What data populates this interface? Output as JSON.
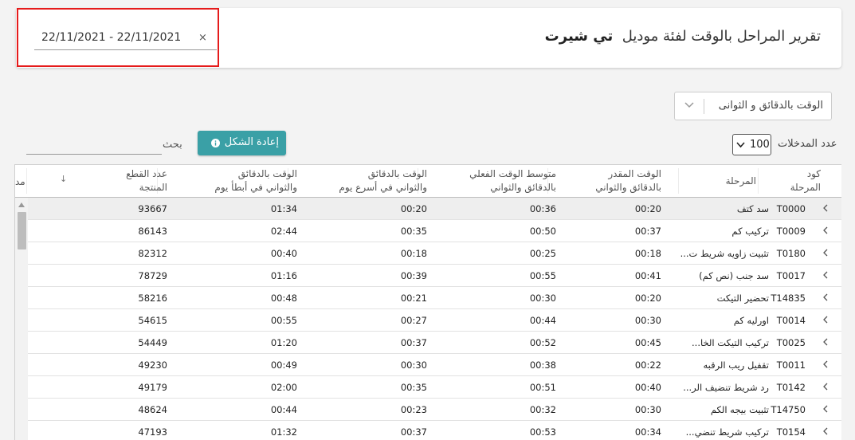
{
  "header": {
    "title": "تقرير المراحل بالوقت لفئة موديل",
    "model": "تي شيرت",
    "date_range": "22/11/2021  -  22/11/2021",
    "clear": "×"
  },
  "controls": {
    "mode_select": "الوقت بالدقائق و الثوانى",
    "entries_label": "عدد المدخلات",
    "entries_value": "100",
    "reset_label": "إعادة الشكل",
    "search_label": "بحث",
    "search_value": "",
    "search_placeholder": ""
  },
  "table": {
    "headers": {
      "code": [
        "كود",
        "المرحلة"
      ],
      "stage": "المرحلة",
      "est": [
        "الوقت المقدر",
        "بالدقائق والثواني"
      ],
      "act": [
        "متوسط الوقت الفعلي",
        "بالدقائق والثواني"
      ],
      "fast": [
        "الوقت بالدقائق",
        "والثواني في أسرع يوم"
      ],
      "slow": [
        "الوقت بالدقائق",
        "والثواني في أبطأ يوم"
      ],
      "cut": [
        "عدد القطع",
        "المنتجة"
      ],
      "trunc": "مد"
    },
    "rows": [
      {
        "code": "T0000",
        "stage": "سد كتف",
        "est": "00:20",
        "act": "00:36",
        "fast": "00:20",
        "slow": "01:34",
        "cut": "93667"
      },
      {
        "code": "T0009",
        "stage": "تركيب كم",
        "est": "00:37",
        "act": "00:50",
        "fast": "00:35",
        "slow": "02:44",
        "cut": "86143"
      },
      {
        "code": "T0180",
        "stage": "تثبيت زاويه شريط ت...",
        "est": "00:18",
        "act": "00:25",
        "fast": "00:18",
        "slow": "00:40",
        "cut": "82312"
      },
      {
        "code": "T0017",
        "stage": "سد جنب (نص كم)",
        "est": "00:41",
        "act": "00:55",
        "fast": "00:39",
        "slow": "01:16",
        "cut": "78729"
      },
      {
        "code": "T14835",
        "stage": "تحضير التيكت",
        "est": "00:20",
        "act": "00:30",
        "fast": "00:21",
        "slow": "00:48",
        "cut": "58216"
      },
      {
        "code": "T0014",
        "stage": "اورليه كم",
        "est": "00:30",
        "act": "00:44",
        "fast": "00:27",
        "slow": "00:55",
        "cut": "54615"
      },
      {
        "code": "T0025",
        "stage": "تركيب التيكت الخا...",
        "est": "00:45",
        "act": "00:52",
        "fast": "00:37",
        "slow": "01:20",
        "cut": "54449"
      },
      {
        "code": "T0011",
        "stage": "تقفيل ريب الرقبه",
        "est": "00:22",
        "act": "00:38",
        "fast": "00:30",
        "slow": "00:49",
        "cut": "49230"
      },
      {
        "code": "T0142",
        "stage": "رد شريط تنضيف الر...",
        "est": "00:40",
        "act": "00:51",
        "fast": "00:35",
        "slow": "02:00",
        "cut": "49179"
      },
      {
        "code": "T14750",
        "stage": "تثبيت بيجه الكم",
        "est": "00:30",
        "act": "00:32",
        "fast": "00:23",
        "slow": "00:44",
        "cut": "48624"
      },
      {
        "code": "T0154",
        "stage": "تركيب شريط تنضي...",
        "est": "00:34",
        "act": "00:53",
        "fast": "00:37",
        "slow": "01:32",
        "cut": "47193"
      }
    ]
  },
  "icons": {
    "expand": "chevron-left-icon",
    "sort": "sort-down-arrow-icon",
    "info": "info-circle-icon"
  },
  "colors": {
    "highlight_border": "#e51b1b",
    "reset_button": "#3aa0a6"
  }
}
